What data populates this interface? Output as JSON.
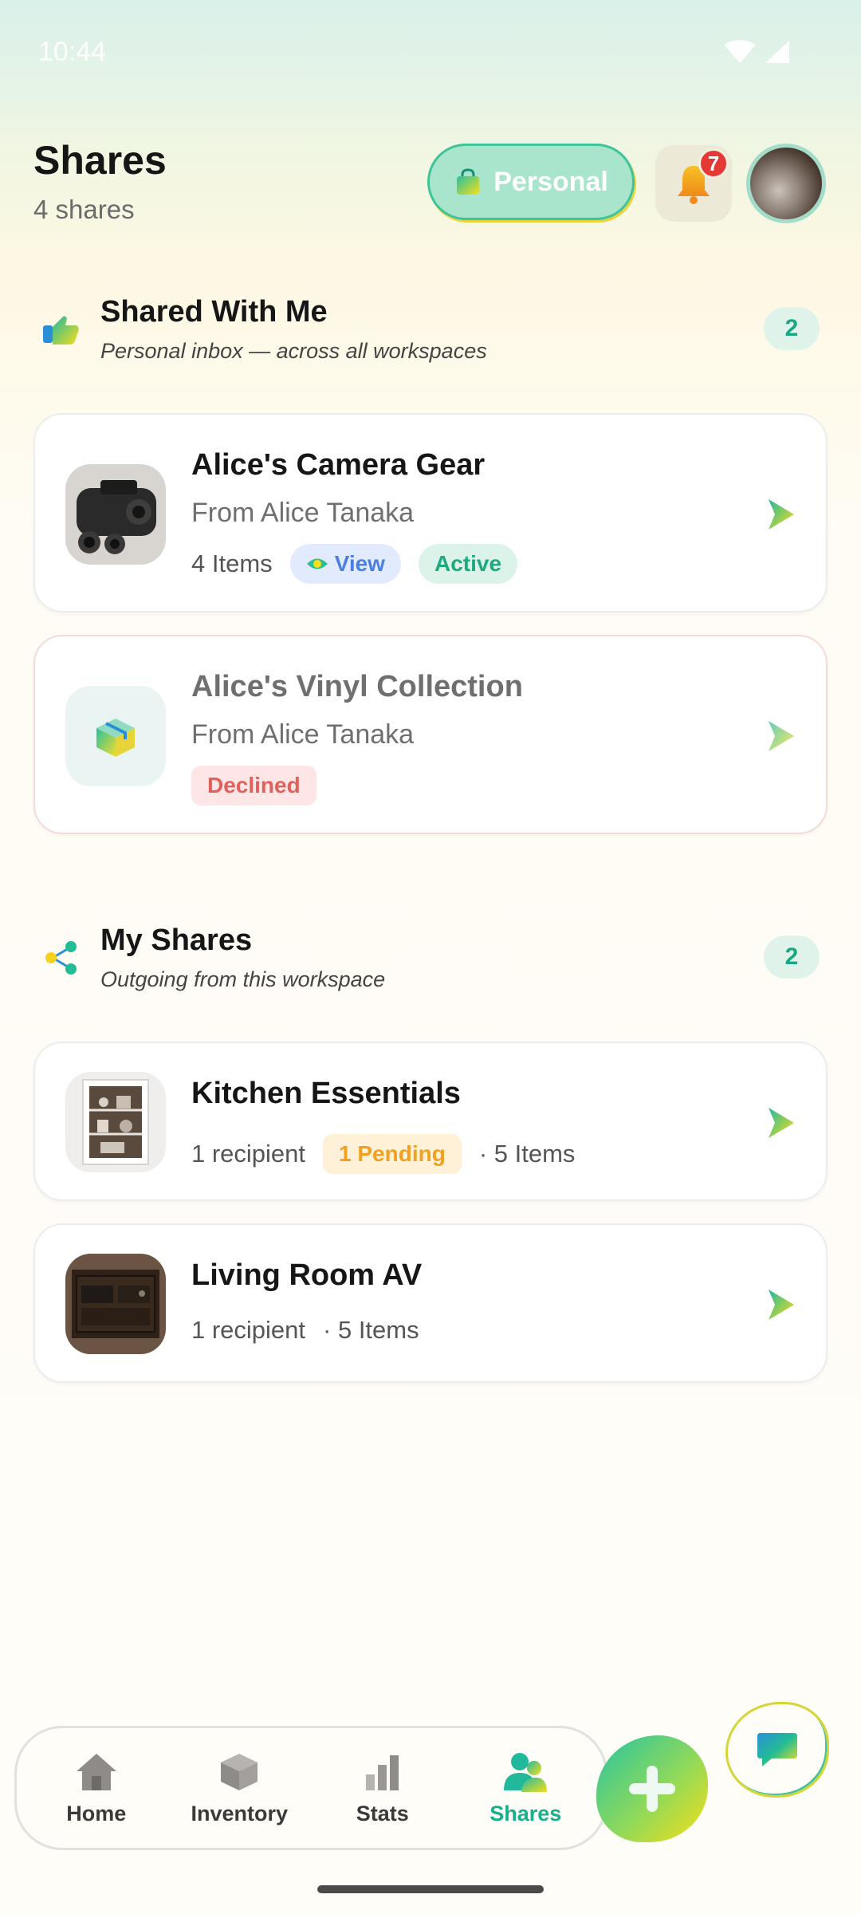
{
  "status_bar": {
    "time": "10:44"
  },
  "header": {
    "title": "Shares",
    "subtitle": "4 shares",
    "workspace_label": "Personal",
    "notification_count": "7"
  },
  "shared_with_me": {
    "title": "Shared With Me",
    "subtitle": "Personal inbox — across all workspaces",
    "count": "2",
    "cards": [
      {
        "title": "Alice's Camera Gear",
        "from": "From Alice Tanaka",
        "items": "4 Items",
        "permission": "View",
        "status": "Active"
      },
      {
        "title": "Alice's Vinyl Collection",
        "from": "From Alice Tanaka",
        "status": "Declined"
      }
    ]
  },
  "my_shares": {
    "title": "My Shares",
    "subtitle": "Outgoing from this workspace",
    "count": "2",
    "cards": [
      {
        "title": "Kitchen Essentials",
        "recipients": "1 recipient",
        "pending": "1 Pending",
        "items": "· 5 Items"
      },
      {
        "title": "Living Room AV",
        "recipients": "1 recipient",
        "items": "· 5 Items"
      }
    ]
  },
  "bottom_nav": {
    "items": [
      {
        "label": "Home",
        "icon": "house-icon"
      },
      {
        "label": "Inventory",
        "icon": "box-icon"
      },
      {
        "label": "Stats",
        "icon": "bar-chart-icon"
      },
      {
        "label": "Shares",
        "icon": "people-icon",
        "active": true
      }
    ]
  },
  "colors": {
    "accent": "#17b08a",
    "accent_yellow": "#f6df18",
    "declined": "#e0605c",
    "pending": "#f2a11f",
    "view": "#4a7fe0"
  }
}
